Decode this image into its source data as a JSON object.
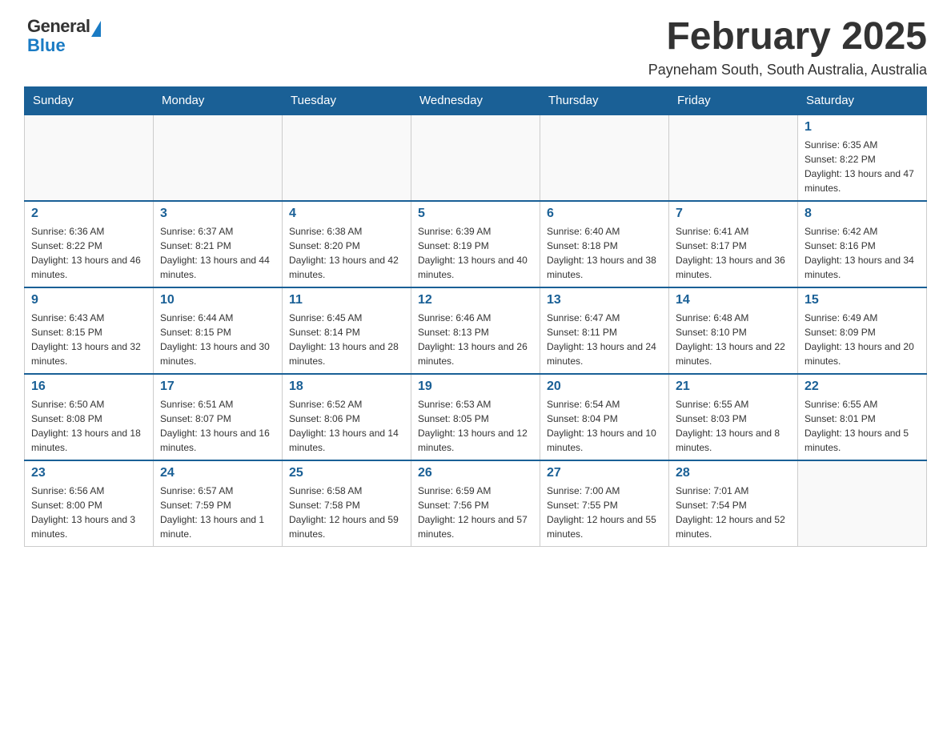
{
  "logo": {
    "general": "General",
    "blue": "Blue"
  },
  "header": {
    "title": "February 2025",
    "subtitle": "Payneham South, South Australia, Australia"
  },
  "weekdays": [
    "Sunday",
    "Monday",
    "Tuesday",
    "Wednesday",
    "Thursday",
    "Friday",
    "Saturday"
  ],
  "weeks": [
    [
      {
        "day": null
      },
      {
        "day": null
      },
      {
        "day": null
      },
      {
        "day": null
      },
      {
        "day": null
      },
      {
        "day": null
      },
      {
        "day": 1,
        "sunrise": "6:35 AM",
        "sunset": "8:22 PM",
        "daylight": "13 hours and 47 minutes."
      }
    ],
    [
      {
        "day": 2,
        "sunrise": "6:36 AM",
        "sunset": "8:22 PM",
        "daylight": "13 hours and 46 minutes."
      },
      {
        "day": 3,
        "sunrise": "6:37 AM",
        "sunset": "8:21 PM",
        "daylight": "13 hours and 44 minutes."
      },
      {
        "day": 4,
        "sunrise": "6:38 AM",
        "sunset": "8:20 PM",
        "daylight": "13 hours and 42 minutes."
      },
      {
        "day": 5,
        "sunrise": "6:39 AM",
        "sunset": "8:19 PM",
        "daylight": "13 hours and 40 minutes."
      },
      {
        "day": 6,
        "sunrise": "6:40 AM",
        "sunset": "8:18 PM",
        "daylight": "13 hours and 38 minutes."
      },
      {
        "day": 7,
        "sunrise": "6:41 AM",
        "sunset": "8:17 PM",
        "daylight": "13 hours and 36 minutes."
      },
      {
        "day": 8,
        "sunrise": "6:42 AM",
        "sunset": "8:16 PM",
        "daylight": "13 hours and 34 minutes."
      }
    ],
    [
      {
        "day": 9,
        "sunrise": "6:43 AM",
        "sunset": "8:15 PM",
        "daylight": "13 hours and 32 minutes."
      },
      {
        "day": 10,
        "sunrise": "6:44 AM",
        "sunset": "8:15 PM",
        "daylight": "13 hours and 30 minutes."
      },
      {
        "day": 11,
        "sunrise": "6:45 AM",
        "sunset": "8:14 PM",
        "daylight": "13 hours and 28 minutes."
      },
      {
        "day": 12,
        "sunrise": "6:46 AM",
        "sunset": "8:13 PM",
        "daylight": "13 hours and 26 minutes."
      },
      {
        "day": 13,
        "sunrise": "6:47 AM",
        "sunset": "8:11 PM",
        "daylight": "13 hours and 24 minutes."
      },
      {
        "day": 14,
        "sunrise": "6:48 AM",
        "sunset": "8:10 PM",
        "daylight": "13 hours and 22 minutes."
      },
      {
        "day": 15,
        "sunrise": "6:49 AM",
        "sunset": "8:09 PM",
        "daylight": "13 hours and 20 minutes."
      }
    ],
    [
      {
        "day": 16,
        "sunrise": "6:50 AM",
        "sunset": "8:08 PM",
        "daylight": "13 hours and 18 minutes."
      },
      {
        "day": 17,
        "sunrise": "6:51 AM",
        "sunset": "8:07 PM",
        "daylight": "13 hours and 16 minutes."
      },
      {
        "day": 18,
        "sunrise": "6:52 AM",
        "sunset": "8:06 PM",
        "daylight": "13 hours and 14 minutes."
      },
      {
        "day": 19,
        "sunrise": "6:53 AM",
        "sunset": "8:05 PM",
        "daylight": "13 hours and 12 minutes."
      },
      {
        "day": 20,
        "sunrise": "6:54 AM",
        "sunset": "8:04 PM",
        "daylight": "13 hours and 10 minutes."
      },
      {
        "day": 21,
        "sunrise": "6:55 AM",
        "sunset": "8:03 PM",
        "daylight": "13 hours and 8 minutes."
      },
      {
        "day": 22,
        "sunrise": "6:55 AM",
        "sunset": "8:01 PM",
        "daylight": "13 hours and 5 minutes."
      }
    ],
    [
      {
        "day": 23,
        "sunrise": "6:56 AM",
        "sunset": "8:00 PM",
        "daylight": "13 hours and 3 minutes."
      },
      {
        "day": 24,
        "sunrise": "6:57 AM",
        "sunset": "7:59 PM",
        "daylight": "13 hours and 1 minute."
      },
      {
        "day": 25,
        "sunrise": "6:58 AM",
        "sunset": "7:58 PM",
        "daylight": "12 hours and 59 minutes."
      },
      {
        "day": 26,
        "sunrise": "6:59 AM",
        "sunset": "7:56 PM",
        "daylight": "12 hours and 57 minutes."
      },
      {
        "day": 27,
        "sunrise": "7:00 AM",
        "sunset": "7:55 PM",
        "daylight": "12 hours and 55 minutes."
      },
      {
        "day": 28,
        "sunrise": "7:01 AM",
        "sunset": "7:54 PM",
        "daylight": "12 hours and 52 minutes."
      },
      {
        "day": null
      }
    ]
  ],
  "labels": {
    "sunrise": "Sunrise:",
    "sunset": "Sunset:",
    "daylight": "Daylight:"
  }
}
